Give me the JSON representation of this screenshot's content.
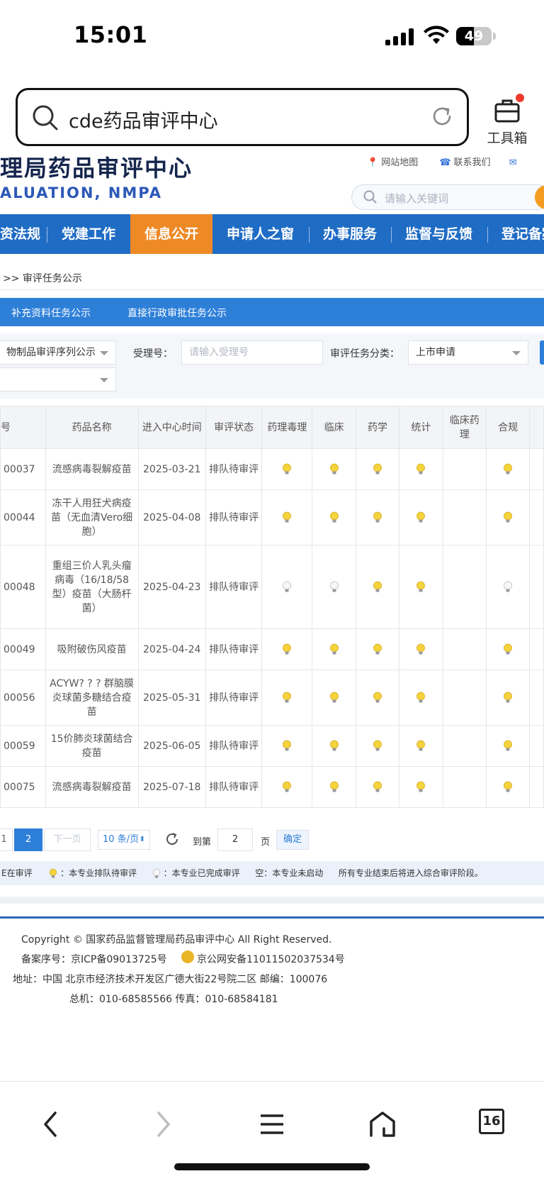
{
  "status": {
    "time": "15:01",
    "battery": "49"
  },
  "browser": {
    "url_text": "cde药品审评中心",
    "toolbox_label": "工具箱",
    "tab_count": "16"
  },
  "site": {
    "logo_cn": "理局药品审评中心",
    "logo_en": "ALUATION, NMPA",
    "sitemap": "网站地图",
    "contact": "联系我们",
    "search_placeholder": "请输入关键词",
    "nav": [
      "资法规",
      "党建工作",
      "信息公开",
      "申请人之窗",
      "办事服务",
      "监督与反馈",
      "登记备案"
    ],
    "breadcrumb": ">> 审评任务公示",
    "tabs": [
      "补充资料任务公示",
      "直接行政审批任务公示"
    ]
  },
  "filter": {
    "seq_select": "物制品审评序列公示",
    "accept_label": "受理号：",
    "accept_placeholder": "请输入受理号",
    "category_label": "审评任务分类：",
    "category_value": "上市申请",
    "second_select": ""
  },
  "table": {
    "headers": [
      "号",
      "药品名称",
      "进入中心时间",
      "审评状态",
      "药理毒理",
      "临床",
      "药学",
      "统计",
      "临床药理",
      "合规"
    ],
    "rows": [
      {
        "num": "00037",
        "name": "流感病毒裂解疫苗",
        "date": "2025-03-21",
        "status": "排队待审评",
        "cells": [
          "yellow",
          "yellow",
          "yellow",
          "yellow",
          "",
          "yellow"
        ]
      },
      {
        "num": "00044",
        "name": "冻干人用狂犬病疫苗（无血清Vero细胞）",
        "date": "2025-04-08",
        "status": "排队待审评",
        "cells": [
          "yellow",
          "yellow",
          "yellow",
          "yellow",
          "",
          "yellow"
        ]
      },
      {
        "num": "00048",
        "name": "重组三价人乳头瘤病毒（16/18/58型）疫苗（大肠杆菌）",
        "date": "2025-04-23",
        "status": "排队待审评",
        "cells": [
          "white",
          "white",
          "yellow",
          "yellow",
          "",
          "white"
        ]
      },
      {
        "num": "00049",
        "name": "吸附破伤风疫苗",
        "date": "2025-04-24",
        "status": "排队待审评",
        "cells": [
          "yellow",
          "yellow",
          "yellow",
          "yellow",
          "",
          "yellow"
        ]
      },
      {
        "num": "00056",
        "name": "ACYW? ? ? 群脑膜炎球菌多糖结合疫苗",
        "date": "2025-05-31",
        "status": "排队待审评",
        "cells": [
          "yellow",
          "yellow",
          "yellow",
          "yellow",
          "",
          "yellow"
        ]
      },
      {
        "num": "00059",
        "name": "15价肺炎球菌结合疫苗",
        "date": "2025-06-05",
        "status": "排队待审评",
        "cells": [
          "yellow",
          "yellow",
          "yellow",
          "yellow",
          "",
          "yellow"
        ]
      },
      {
        "num": "00075",
        "name": "流感病毒裂解疫苗",
        "date": "2025-07-18",
        "status": "排队待审评",
        "cells": [
          "yellow",
          "yellow",
          "yellow",
          "yellow",
          "",
          "yellow"
        ]
      }
    ]
  },
  "pager": {
    "page1": "1",
    "page2": "2",
    "next": "下一页",
    "size": "10 条/页",
    "goto": "到第",
    "goto_value": "2",
    "page_unit": "页",
    "confirm": "确定"
  },
  "legend": {
    "in_review": "E在审评",
    "queued": "：本专业排队待审评",
    "done": "：本专业已完成审评",
    "not_started": "空：本专业未启动",
    "note": "所有专业结束后将进入综合审评阶段。"
  },
  "footer": {
    "copyright": "Copyright © 国家药品监督管理局药品审评中心    All Right Reserved.",
    "icp": "备案序号：京ICP备09013725号",
    "police": "京公网安备11011502037534号",
    "address": "地址：中国 北京市经济技术开发区广德大街22号院二区       邮编：100076",
    "phone": "总机：010-68585566       传真：010-68584181"
  },
  "colors": {
    "nav_blue": "#1f6cc5",
    "nav_active": "#ee8a26",
    "tab_blue": "#2d7fd8",
    "bulb_yellow": "#f4d33c",
    "bulb_white": "#ececec"
  }
}
